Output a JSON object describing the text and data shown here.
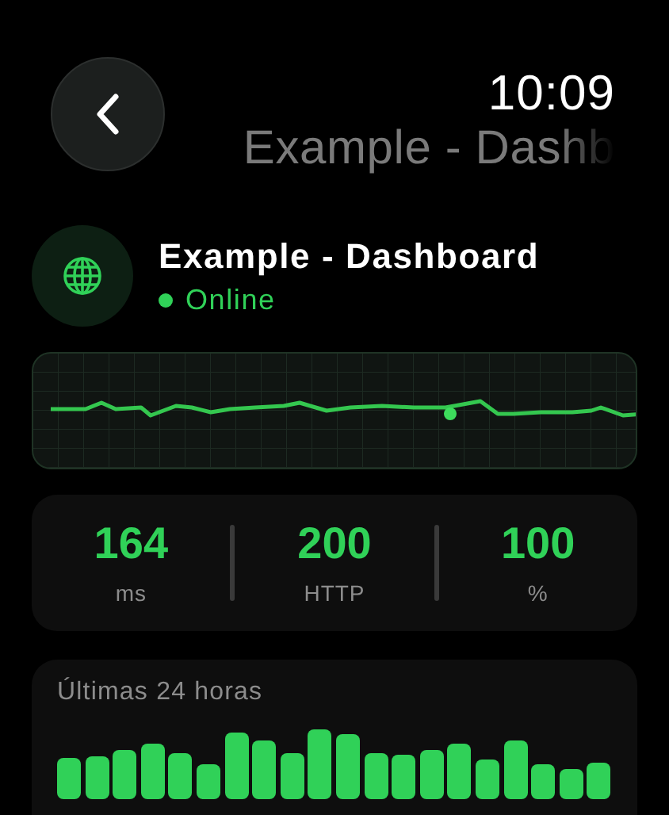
{
  "nav": {
    "time": "10:09",
    "title": "Example - Dashb"
  },
  "site": {
    "name": "Example - Dashboard",
    "status": "Online",
    "online": true
  },
  "stats": [
    {
      "value": "164",
      "unit": "ms"
    },
    {
      "value": "200",
      "unit": "HTTP"
    },
    {
      "value": "100",
      "unit": "%"
    }
  ],
  "history": {
    "title": "Últimas 24 horas"
  }
}
